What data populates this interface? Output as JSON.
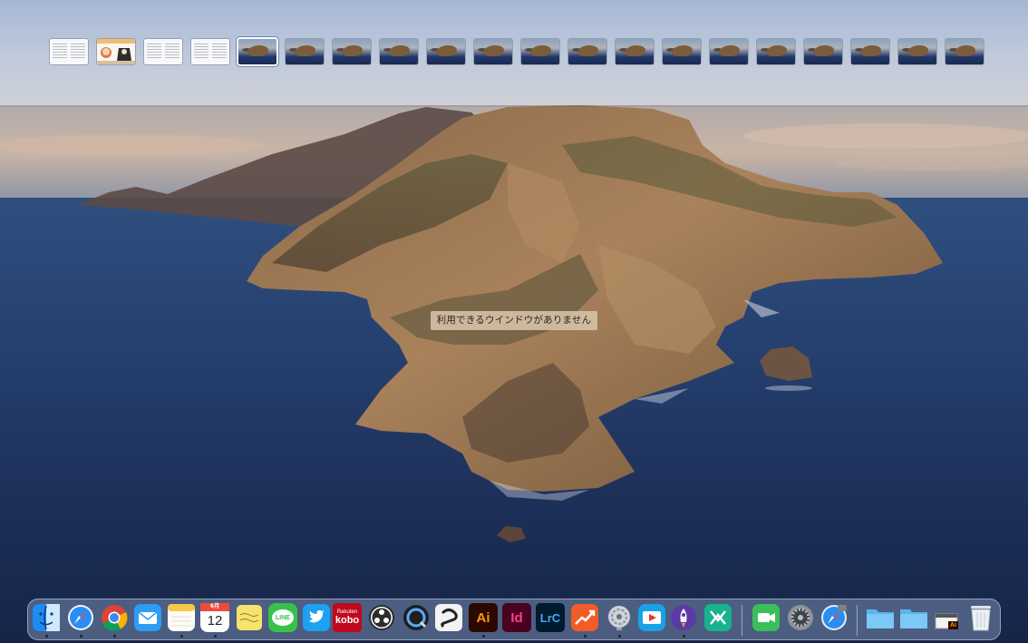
{
  "desktop": {
    "no_windows_message": "利用できるウインドウがありません"
  },
  "spaces": {
    "count": 20,
    "items": [
      {
        "type": "doc"
      },
      {
        "type": "art"
      },
      {
        "type": "doc"
      },
      {
        "type": "doc"
      },
      {
        "type": "wallpaper",
        "active": true
      },
      {
        "type": "wallpaper"
      },
      {
        "type": "wallpaper"
      },
      {
        "type": "wallpaper"
      },
      {
        "type": "wallpaper"
      },
      {
        "type": "wallpaper"
      },
      {
        "type": "wallpaper"
      },
      {
        "type": "wallpaper"
      },
      {
        "type": "wallpaper"
      },
      {
        "type": "wallpaper"
      },
      {
        "type": "wallpaper"
      },
      {
        "type": "wallpaper"
      },
      {
        "type": "wallpaper"
      },
      {
        "type": "wallpaper"
      },
      {
        "type": "wallpaper"
      },
      {
        "type": "wallpaper"
      }
    ]
  },
  "dock": {
    "apps": [
      {
        "name": "finder",
        "icon": "finder-icon",
        "running": true
      },
      {
        "name": "safari",
        "icon": "safari-icon",
        "running": true
      },
      {
        "name": "chrome",
        "icon": "chrome-icon",
        "running": true
      },
      {
        "name": "mail",
        "icon": "mail-icon",
        "running": false
      },
      {
        "name": "notes",
        "icon": "notes-icon",
        "running": true
      },
      {
        "name": "calendar",
        "icon": "calendar-icon",
        "running": true,
        "month": "6月",
        "day": "12"
      },
      {
        "name": "stickies",
        "icon": "stickies-icon",
        "running": false
      },
      {
        "name": "line",
        "icon": "line-icon",
        "running": false,
        "label": "LINE"
      },
      {
        "name": "twitter",
        "icon": "twitter-bird-icon",
        "running": false
      },
      {
        "name": "kobo",
        "icon": "rakuten-kobo-icon",
        "running": false,
        "label_top": "Rakuten",
        "label": "kobo"
      },
      {
        "name": "obs",
        "icon": "obs-icon",
        "running": false
      },
      {
        "name": "quicktime",
        "icon": "quicktime-icon",
        "running": false
      },
      {
        "name": "clip-studio",
        "icon": "clip-studio-icon",
        "running": false
      },
      {
        "name": "illustrator",
        "icon": "illustrator-icon",
        "running": true,
        "label": "Ai"
      },
      {
        "name": "indesign",
        "icon": "indesign-icon",
        "running": false,
        "label": "Id"
      },
      {
        "name": "lightroom-classic",
        "icon": "lightroom-classic-icon",
        "running": false,
        "label": "LrC"
      },
      {
        "name": "activity-chart",
        "icon": "chart-arrow-icon",
        "running": true
      },
      {
        "name": "app-launcher",
        "icon": "launcher-wheel-icon",
        "running": true
      },
      {
        "name": "video-player",
        "icon": "video-play-icon",
        "running": false
      },
      {
        "name": "rocket-typist",
        "icon": "rocket-icon",
        "running": true
      },
      {
        "name": "tower",
        "icon": "merge-icon",
        "running": false
      },
      {
        "name": "facetime",
        "icon": "facetime-icon",
        "running": false
      },
      {
        "name": "system-preferences",
        "icon": "gear-icon",
        "running": false
      },
      {
        "name": "safari-technology-preview",
        "icon": "compass-icon",
        "running": false
      }
    ],
    "folders": [
      {
        "name": "applications-folder",
        "icon": "folder-icon"
      },
      {
        "name": "documents-folder",
        "icon": "folder-icon"
      },
      {
        "name": "illustrator-file",
        "icon": "illustrator-file-icon",
        "label": "Ai"
      },
      {
        "name": "trash",
        "icon": "trash-icon"
      }
    ]
  },
  "colors": {
    "spaces_bar": "#bcc7da",
    "message_bg": "#d7c4a8",
    "dock_bg": "#788caf"
  }
}
